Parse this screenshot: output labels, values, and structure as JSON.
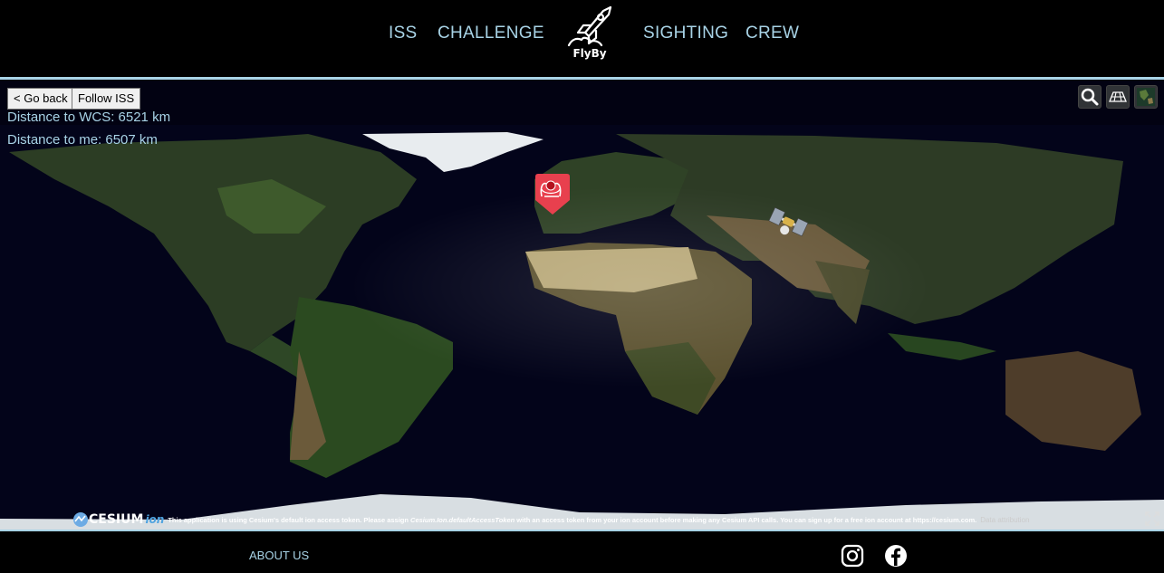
{
  "nav": {
    "left": [
      "ISS",
      "CHALLENGE"
    ],
    "right": [
      "SIGHTING",
      "CREW"
    ],
    "logo_text": "FlyBy"
  },
  "controls": {
    "go_back": "< Go back",
    "follow": "Follow ISS"
  },
  "info": {
    "distance_wcs": "Distance to WCS: 6521 km",
    "distance_me": "Distance to me: 6507 km"
  },
  "toolbar": {
    "icons": [
      "search-icon",
      "grid-icon",
      "globe-icon"
    ]
  },
  "credits": {
    "logo": "CESIUM",
    "logo_suffix": "ion",
    "message_part1": "This application is using Cesium's default ion access token. Please assign ",
    "message_code": "Cesium.Ion.defaultAccessToken",
    "message_part2": " with an access token from your ion account before making any Cesium API calls. You can sign up for a free ion account at https://cesium.com.",
    "data_attribution": "Data attribution"
  },
  "footer": {
    "about": "ABOUT US",
    "social": [
      "instagram-icon",
      "facebook-icon"
    ]
  },
  "colors": {
    "accent": "#a8d3e6",
    "marker": "#e8404e"
  }
}
